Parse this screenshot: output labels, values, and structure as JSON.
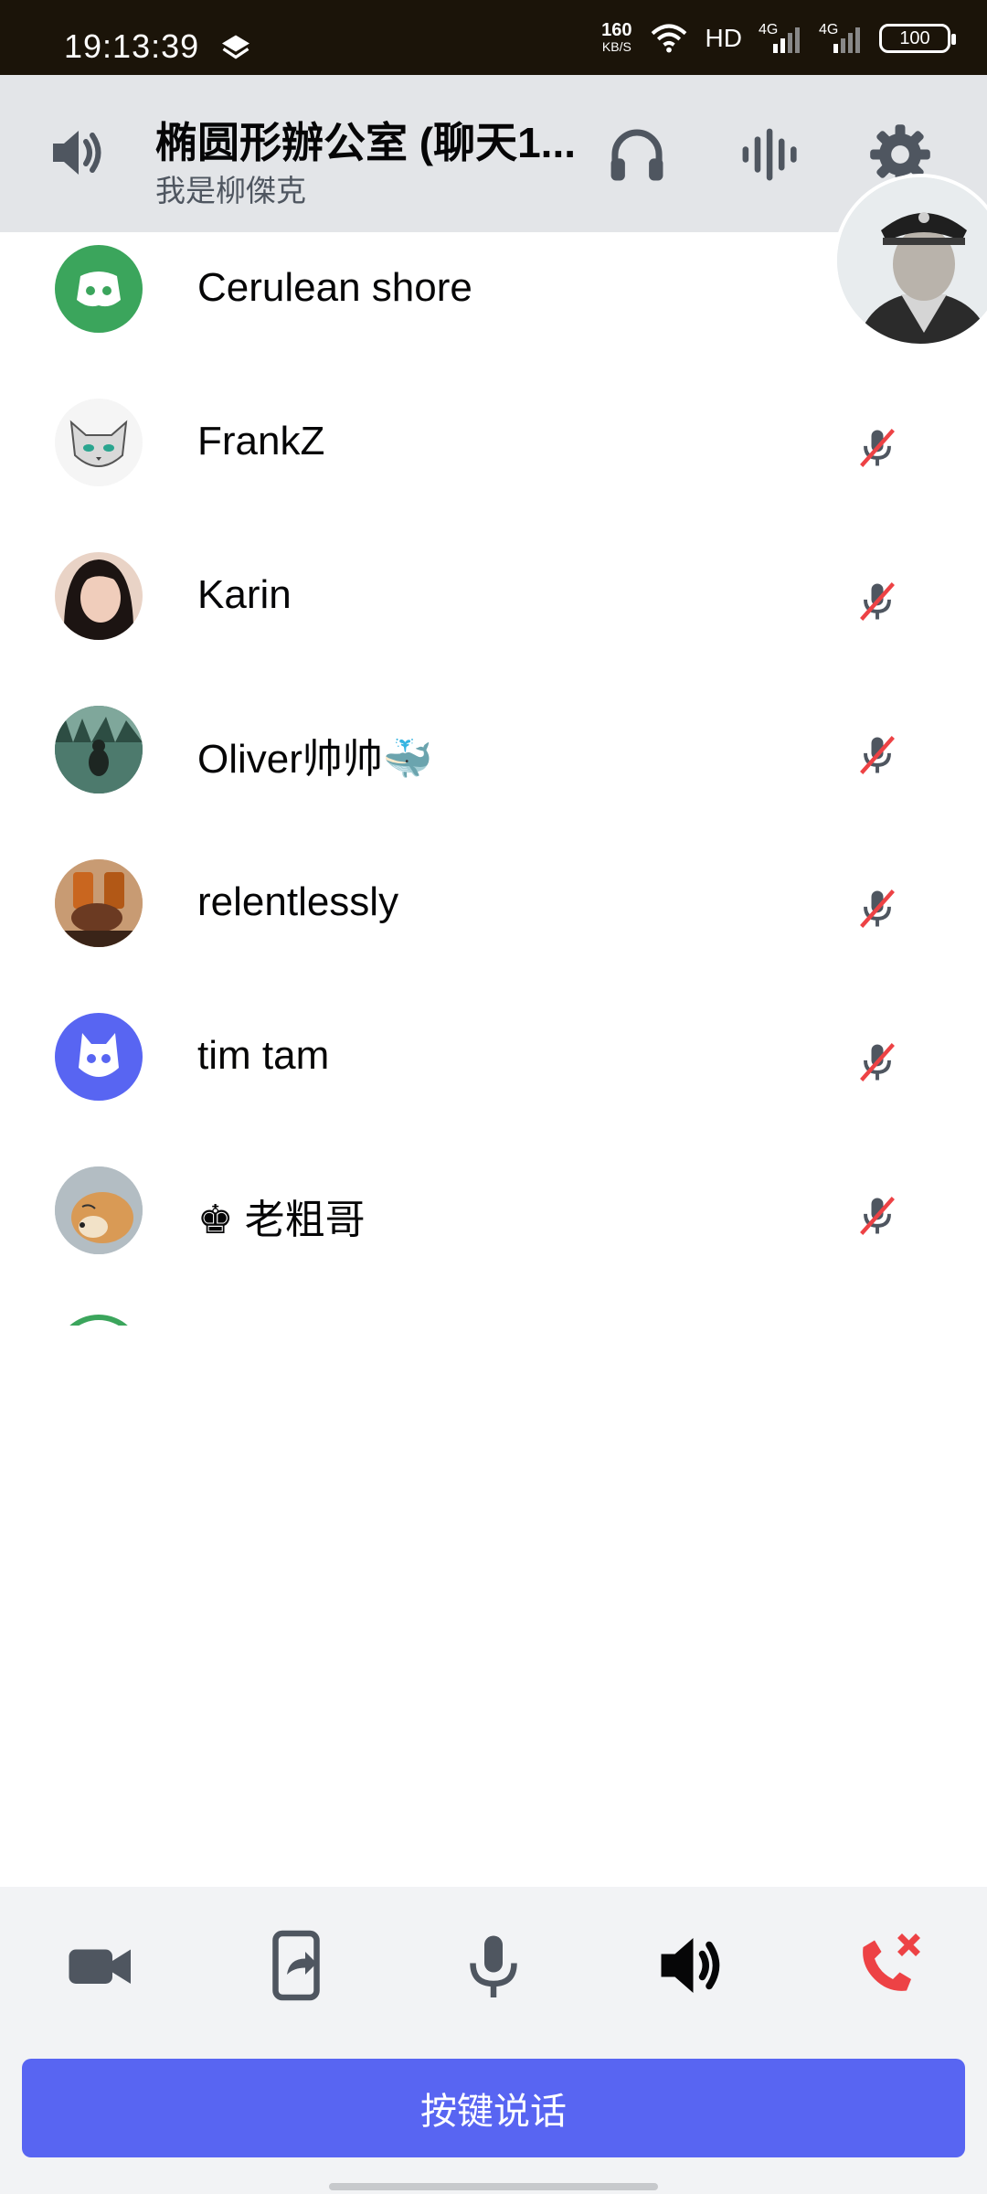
{
  "status_bar": {
    "time": "19:13:39",
    "speed_value": "160",
    "speed_unit": "KB/S",
    "hd_label": "HD",
    "net1": "4G",
    "net2": "4G",
    "battery": "100"
  },
  "header": {
    "channel_title": "椭圆形辦公室 (聊天1...",
    "subtitle": "我是柳傑克",
    "icons": [
      "speaker-icon",
      "headphones-icon",
      "voice-activity-icon",
      "gear-icon"
    ]
  },
  "participants": [
    {
      "name": "Cerulean shore",
      "avatar": "discord-logo-green",
      "muted": false
    },
    {
      "name": "FrankZ",
      "avatar": "cat-sketch",
      "muted": true
    },
    {
      "name": "Karin",
      "avatar": "photo-person",
      "muted": true
    },
    {
      "name": "Oliver帅帅🐳",
      "avatar": "photo-forest",
      "muted": true
    },
    {
      "name": "relentlessly",
      "avatar": "photo-cheers",
      "muted": true
    },
    {
      "name": "tim tam",
      "avatar": "discord-logo-blurple",
      "muted": true
    },
    {
      "name": "♚ 老粗哥",
      "avatar": "photo-dog",
      "muted": true
    }
  ],
  "controls": {
    "icons": [
      "video-camera-icon",
      "screen-share-icon",
      "microphone-icon",
      "speaker-icon",
      "hang-up-icon"
    ],
    "push_to_talk_label": "按键说话"
  },
  "colors": {
    "status_bar_bg": "#1b1409",
    "header_bg": "#e3e5e8",
    "accent": "#5865f2",
    "green": "#3ba55c",
    "danger": "#ed4245",
    "controls_bg": "#f2f3f5"
  }
}
